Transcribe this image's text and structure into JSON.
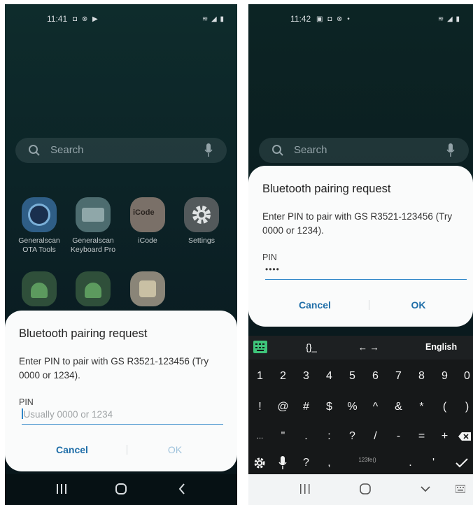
{
  "left_screen": {
    "status": {
      "time": "11:41",
      "icons": "◘ ⊗ ▶",
      "right_icons": "≋ ◢ ▮"
    },
    "search": {
      "placeholder": "Search"
    },
    "apps": [
      {
        "label": "Generalscan OTA Tools",
        "icon": "generalscan-ota-icon"
      },
      {
        "label": "Generalscan Keyboard Pro",
        "icon": "keyboard-icon"
      },
      {
        "label": "iCode",
        "icon": "icode-icon"
      },
      {
        "label": "Settings",
        "icon": "gear-icon"
      },
      {
        "label": "",
        "icon": "android-icon"
      },
      {
        "label": "",
        "icon": "android-icon"
      },
      {
        "label": "",
        "icon": "bluetooth-device-icon"
      }
    ],
    "dialog": {
      "title": "Bluetooth pairing request",
      "message": "Enter PIN to pair with GS R3521-123456 (Try 0000 or 1234).",
      "pin_label": "PIN",
      "pin_placeholder": "Usually 0000 or 1234",
      "pin_value": "",
      "cancel_label": "Cancel",
      "ok_label": "OK",
      "ok_enabled": false
    }
  },
  "right_screen": {
    "status": {
      "time": "11:42",
      "icons": "▣ ◘ ⊗ •",
      "right_icons": "≋ ◢ ▮"
    },
    "search": {
      "placeholder": "Search"
    },
    "dialog": {
      "title": "Bluetooth pairing request",
      "message": "Enter PIN to pair with GS R3521-123456 (Try 0000 or 1234).",
      "pin_label": "PIN",
      "pin_value": "••••",
      "cancel_label": "Cancel",
      "ok_label": "OK",
      "ok_enabled": true
    },
    "keyboard": {
      "toolbar": {
        "braces": "{}_",
        "arrows": "← →",
        "language": "English"
      },
      "row1": [
        "1",
        "2",
        "3",
        "4",
        "5",
        "6",
        "7",
        "8",
        "9",
        "0"
      ],
      "row2": [
        "!",
        "@",
        "#",
        "$",
        "%",
        "^",
        "&",
        "*",
        "(",
        ")"
      ],
      "row3": [
        "...",
        "\"",
        ".",
        ":",
        "?",
        "/",
        "-",
        "=",
        "+"
      ],
      "row4": [
        "?",
        ",",
        "123fe()",
        ".",
        "'"
      ]
    }
  },
  "colors": {
    "accent": "#1f6ea8",
    "underline": "#2f86c8",
    "dialog_bg": "#fafbfb",
    "keyboard_bg": "#161819"
  }
}
